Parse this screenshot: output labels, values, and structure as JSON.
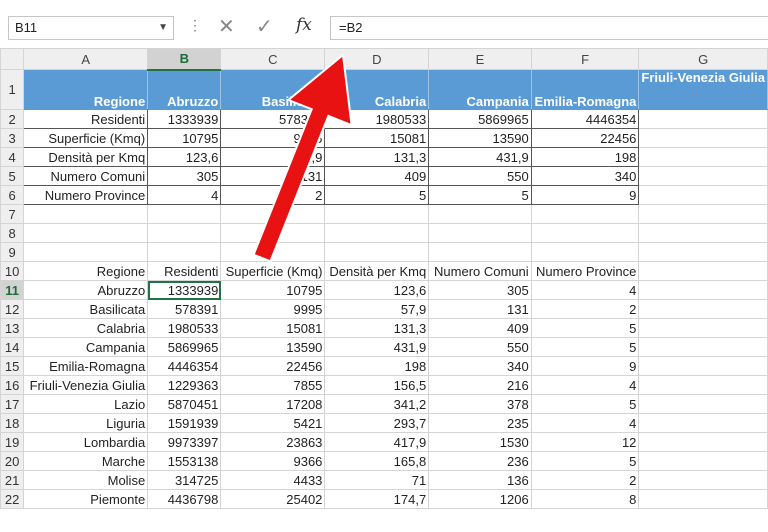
{
  "formula_bar": {
    "name_box": "B11",
    "separator": "⋮",
    "cancel": "✕",
    "enter": "✓",
    "fx": "fx",
    "formula": "=B2"
  },
  "columns": [
    "A",
    "B",
    "C",
    "D",
    "E",
    "F",
    "G"
  ],
  "selected_column": "B",
  "selected_row": 11,
  "rows": [
    {
      "n": "1",
      "cells": [
        "Regione",
        "Abruzzo",
        "Basilicata",
        "Calabria",
        "Campania",
        "Emilia-Romagna",
        "Friuli-Venezia Giulia"
      ]
    },
    {
      "n": "2",
      "cells": [
        "Residenti",
        "1333939",
        "578391",
        "1980533",
        "5869965",
        "4446354",
        ""
      ]
    },
    {
      "n": "3",
      "cells": [
        "Superficie (Kmq)",
        "10795",
        "9995",
        "15081",
        "13590",
        "22456",
        ""
      ]
    },
    {
      "n": "4",
      "cells": [
        "Densità per Kmq",
        "123,6",
        "57,9",
        "131,3",
        "431,9",
        "198",
        ""
      ]
    },
    {
      "n": "5",
      "cells": [
        "Numero Comuni",
        "305",
        "131",
        "409",
        "550",
        "340",
        ""
      ]
    },
    {
      "n": "6",
      "cells": [
        "Numero Province",
        "4",
        "2",
        "5",
        "5",
        "9",
        ""
      ]
    },
    {
      "n": "7",
      "cells": [
        "",
        "",
        "",
        "",
        "",
        "",
        ""
      ]
    },
    {
      "n": "8",
      "cells": [
        "",
        "",
        "",
        "",
        "",
        "",
        ""
      ]
    },
    {
      "n": "9",
      "cells": [
        "",
        "",
        "",
        "",
        "",
        "",
        ""
      ]
    },
    {
      "n": "10",
      "cells": [
        "Regione",
        "Residenti",
        "Superficie (Kmq)",
        "Densità per Kmq",
        "Numero Comuni",
        "Numero Province",
        ""
      ]
    },
    {
      "n": "11",
      "cells": [
        "Abruzzo",
        "1333939",
        "10795",
        "123,6",
        "305",
        "4",
        ""
      ]
    },
    {
      "n": "12",
      "cells": [
        "Basilicata",
        "578391",
        "9995",
        "57,9",
        "131",
        "2",
        ""
      ]
    },
    {
      "n": "13",
      "cells": [
        "Calabria",
        "1980533",
        "15081",
        "131,3",
        "409",
        "5",
        ""
      ]
    },
    {
      "n": "14",
      "cells": [
        "Campania",
        "5869965",
        "13590",
        "431,9",
        "550",
        "5",
        ""
      ]
    },
    {
      "n": "15",
      "cells": [
        "Emilia-Romagna",
        "4446354",
        "22456",
        "198",
        "340",
        "9",
        ""
      ]
    },
    {
      "n": "16",
      "cells": [
        "Friuli-Venezia Giulia",
        "1229363",
        "7855",
        "156,5",
        "216",
        "4",
        ""
      ]
    },
    {
      "n": "17",
      "cells": [
        "Lazio",
        "5870451",
        "17208",
        "341,2",
        "378",
        "5",
        ""
      ]
    },
    {
      "n": "18",
      "cells": [
        "Liguria",
        "1591939",
        "5421",
        "293,7",
        "235",
        "4",
        ""
      ]
    },
    {
      "n": "19",
      "cells": [
        "Lombardia",
        "9973397",
        "23863",
        "417,9",
        "1530",
        "12",
        ""
      ]
    },
    {
      "n": "20",
      "cells": [
        "Marche",
        "1553138",
        "9366",
        "165,8",
        "236",
        "5",
        ""
      ]
    },
    {
      "n": "21",
      "cells": [
        "Molise",
        "314725",
        "4433",
        "71",
        "136",
        "2",
        ""
      ]
    },
    {
      "n": "22",
      "cells": [
        "Piemonte",
        "4436798",
        "25402",
        "174,7",
        "1206",
        "8",
        ""
      ]
    }
  ],
  "colors": {
    "header_fill": "#5b9bd5",
    "arrow": "#e81212",
    "selection": "#217346"
  },
  "annotation": {
    "icon": "red-arrow-icon",
    "points_to": "formula"
  }
}
